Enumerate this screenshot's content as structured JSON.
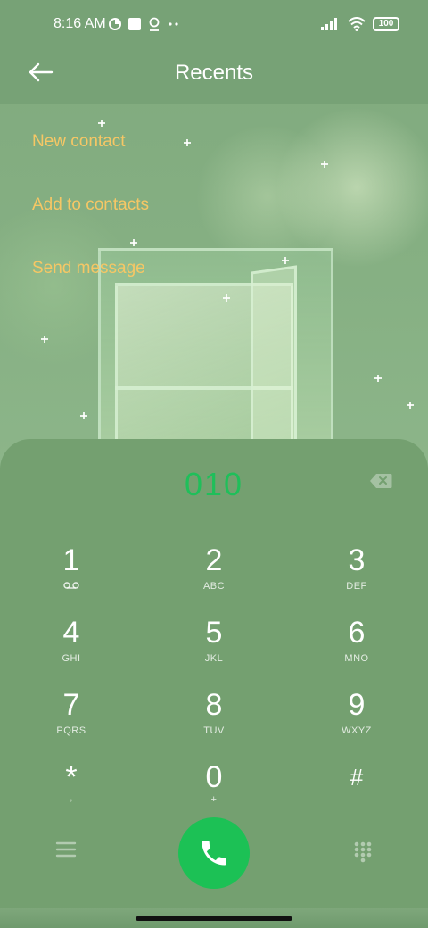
{
  "status_bar": {
    "time": "8:16 AM",
    "battery": "100",
    "icons_left": [
      "vpn-icon",
      "square-icon",
      "location-icon",
      "more-dots-icon"
    ],
    "icons_right": [
      "signal-icon",
      "wifi-icon",
      "battery-icon"
    ]
  },
  "header": {
    "title": "Recents",
    "back_icon": "back-arrow-icon"
  },
  "actions": {
    "new_contact": "New contact",
    "add_to_contacts": "Add to contacts",
    "send_message": "Send message"
  },
  "dialer": {
    "number": "010",
    "keys": [
      {
        "digit": "1",
        "letters": ""
      },
      {
        "digit": "2",
        "letters": "ABC"
      },
      {
        "digit": "3",
        "letters": "DEF"
      },
      {
        "digit": "4",
        "letters": "GHI"
      },
      {
        "digit": "5",
        "letters": "JKL"
      },
      {
        "digit": "6",
        "letters": "MNO"
      },
      {
        "digit": "7",
        "letters": "PQRS"
      },
      {
        "digit": "8",
        "letters": "TUV"
      },
      {
        "digit": "9",
        "letters": "WXYZ"
      },
      {
        "digit": "*",
        "letters": ","
      },
      {
        "digit": "0",
        "letters": "+"
      },
      {
        "digit": "#",
        "letters": ""
      }
    ],
    "icons": {
      "delete": "backspace-icon",
      "menu": "hamburger-menu-icon",
      "call": "phone-icon",
      "keypad": "dialpad-icon",
      "voicemail": "voicemail-icon"
    }
  },
  "colors": {
    "background": "#77a276",
    "accent_text": "#f6c765",
    "number_green": "#1fbf5a",
    "call_button": "#1cc155"
  }
}
